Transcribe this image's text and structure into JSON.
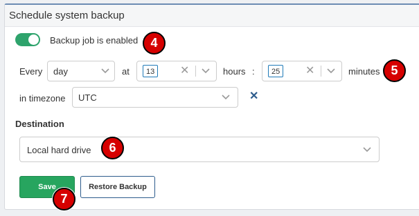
{
  "panel": {
    "title": "Schedule system backup"
  },
  "backup_toggle": {
    "label": "Backup job is enabled",
    "enabled": true,
    "accent": "#2ea36c"
  },
  "schedule": {
    "every_label": "Every",
    "frequency_value": "day",
    "at_label": "at",
    "hour_value": "13",
    "hours_label": "hours",
    "separator": ":",
    "minute_value": "25",
    "minutes_label": "minutes"
  },
  "timezone": {
    "label": "in timezone",
    "value": "UTC",
    "clear_glyph": "✕"
  },
  "destination": {
    "label": "Destination",
    "value": "Local hard drive"
  },
  "buttons": {
    "save": "Save",
    "restore": "Restore Backup",
    "save_color": "#27a55f"
  },
  "annotations": {
    "badge_4": "4",
    "badge_5": "5",
    "badge_6": "6",
    "badge_7": "7",
    "color": "#d60000"
  },
  "icons": {
    "chevron": "chevron-down-icon",
    "clear": "clear-icon",
    "close": "close-icon"
  }
}
